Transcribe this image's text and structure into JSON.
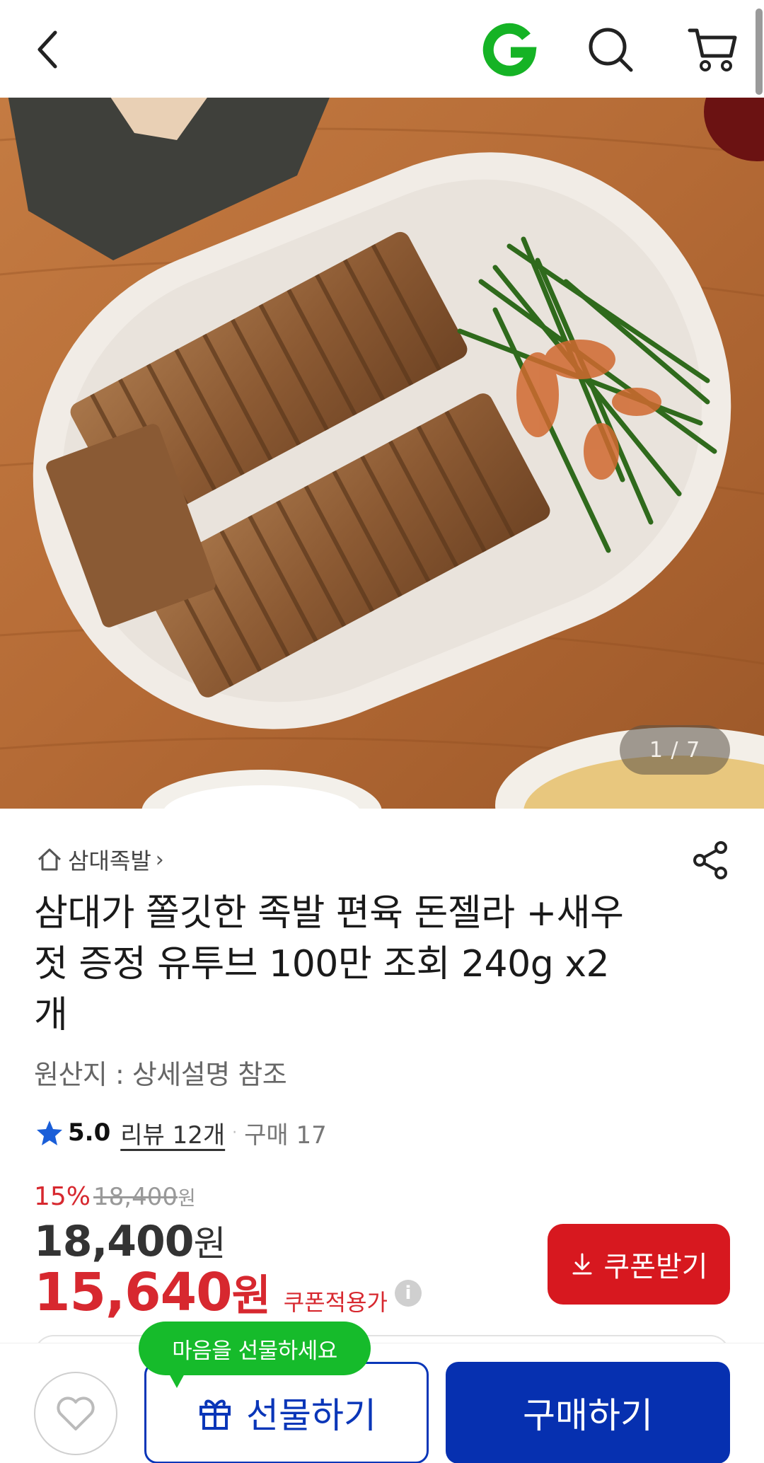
{
  "header": {
    "back_icon": "chevron-left-icon",
    "logo_icon": "g-logo-icon",
    "logo_color": "#15b325",
    "search_icon": "search-icon",
    "cart_icon": "cart-icon"
  },
  "gallery": {
    "counter": "1 / 7",
    "image_subject": "sliced pork hock jelly and chive kimchi on white oval plate"
  },
  "product": {
    "store_name": "삼대족발",
    "title_lines": [
      "삼대가 쫄깃한 족발 편육 돈젤라 +새우",
      "젓 증정 유투브 100만 조회 240g x2",
      "개"
    ],
    "origin": "원산지 : 상세설명 참조",
    "rating": "5.0",
    "review_link": "리뷰 12개",
    "separator": "·",
    "purchase_count": "구매 17"
  },
  "pricing": {
    "discount_rate": "15%",
    "original_price": "18,400",
    "original_unit": "원",
    "price": "18,400",
    "price_unit": "원",
    "coupon_price": "15,640",
    "coupon_unit": "원",
    "coupon_label": "쿠폰적용가",
    "info_icon": "i",
    "coupon_button": "쿠폰받기",
    "accent_color": "#d7282f"
  },
  "bottom_bar": {
    "tooltip": "마음을 선물하세요",
    "gift_button": "선물하기",
    "buy_button": "구매하기",
    "primary_color": "#0630b0",
    "tooltip_color": "#16bb2b"
  }
}
